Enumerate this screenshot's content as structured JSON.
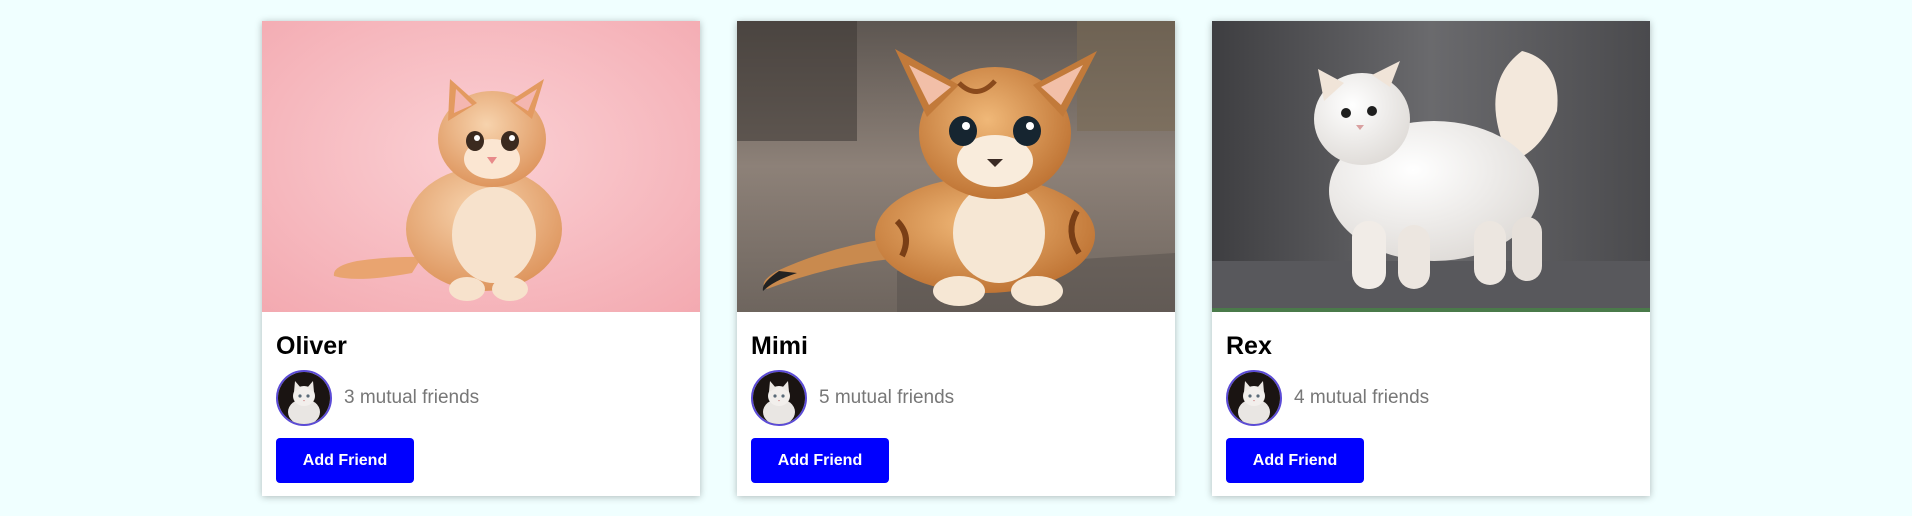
{
  "theme": {
    "page_background": "#f0ffff",
    "button_color": "#0000ff",
    "avatar_border": "#5b4bd6"
  },
  "cards": [
    {
      "name": "Oliver",
      "mutual_text": "3 mutual friends",
      "button_label": "Add Friend",
      "photo": "orange-kitten-on-pink-background",
      "avatar": "white-cat-avatar"
    },
    {
      "name": "Mimi",
      "mutual_text": "5 mutual friends",
      "button_label": "Add Friend",
      "photo": "tabby-kitten-lying-on-floor",
      "avatar": "white-cat-avatar"
    },
    {
      "name": "Rex",
      "mutual_text": "4 mutual friends",
      "button_label": "Add Friend",
      "photo": "white-persian-cat-on-gray-background",
      "avatar": "white-cat-avatar"
    }
  ]
}
